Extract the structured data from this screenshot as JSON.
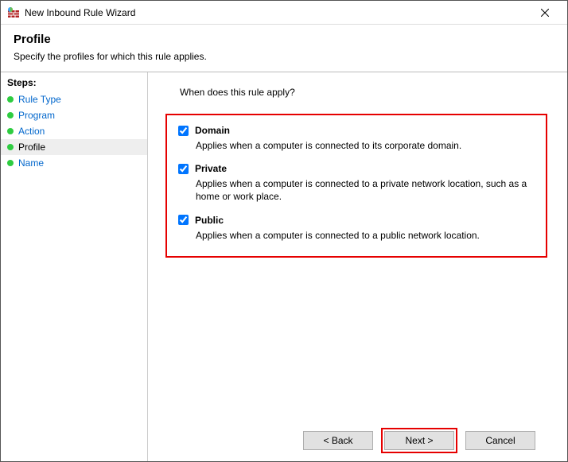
{
  "titlebar": {
    "title": "New Inbound Rule Wizard"
  },
  "header": {
    "heading": "Profile",
    "subtext": "Specify the profiles for which this rule applies."
  },
  "sidebar": {
    "label": "Steps:",
    "items": [
      {
        "label": "Rule Type"
      },
      {
        "label": "Program"
      },
      {
        "label": "Action"
      },
      {
        "label": "Profile"
      },
      {
        "label": "Name"
      }
    ],
    "current_index": 3
  },
  "content": {
    "prompt": "When does this rule apply?",
    "options": [
      {
        "label": "Domain",
        "checked": true,
        "desc": "Applies when a computer is connected to its corporate domain."
      },
      {
        "label": "Private",
        "checked": true,
        "desc": "Applies when a computer is connected to a private network location, such as a home or work place."
      },
      {
        "label": "Public",
        "checked": true,
        "desc": "Applies when a computer is connected to a public network location."
      }
    ]
  },
  "footer": {
    "back": "< Back",
    "next": "Next >",
    "cancel": "Cancel"
  }
}
